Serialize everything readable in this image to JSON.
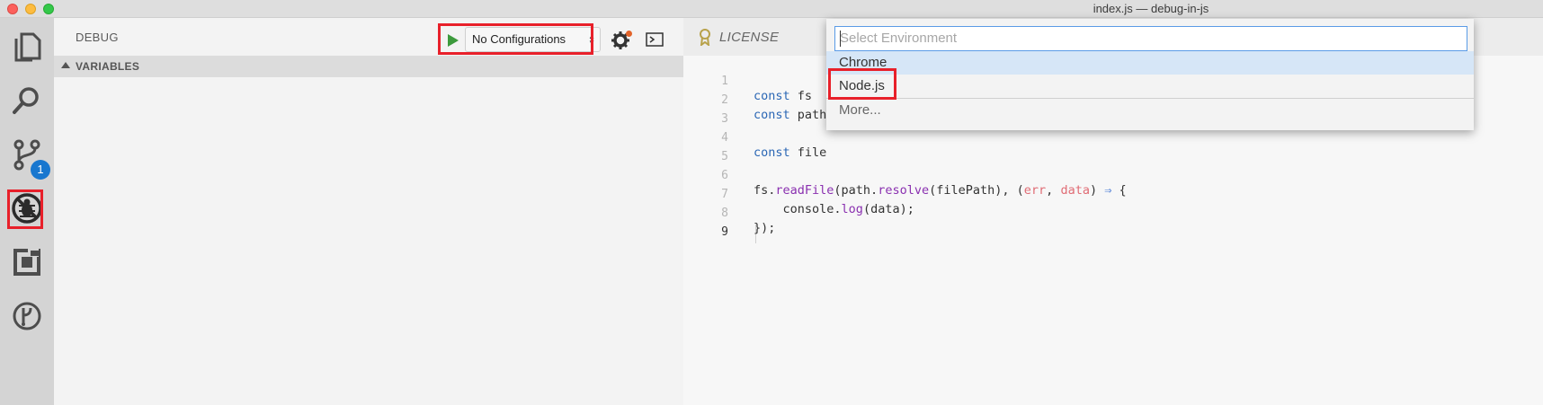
{
  "window": {
    "title": "index.js — debug-in-js"
  },
  "activity_bar": {
    "items": [
      {
        "name": "explorer",
        "icon": "files-icon"
      },
      {
        "name": "search",
        "icon": "search-icon"
      },
      {
        "name": "source-control",
        "icon": "source-control-icon",
        "badge": "1"
      },
      {
        "name": "debug",
        "icon": "debug-icon"
      },
      {
        "name": "extensions",
        "icon": "extensions-icon"
      },
      {
        "name": "remote",
        "icon": "remote-icon"
      }
    ]
  },
  "debug_panel": {
    "title": "DEBUG",
    "configuration": "No Configurations",
    "sections": [
      {
        "label": "VARIABLES",
        "expanded": true
      }
    ]
  },
  "editor": {
    "tab": {
      "label": "LICENSE",
      "icon": "license-icon"
    },
    "lines": [
      {
        "number": "1",
        "text": "const fs "
      },
      {
        "number": "2",
        "text": "const path"
      },
      {
        "number": "3",
        "text": ""
      },
      {
        "number": "4",
        "text": "const file"
      },
      {
        "number": "5",
        "text": ""
      },
      {
        "number": "6",
        "text": "fs.readFile(path.resolve(filePath), (err, data) ⇒ {"
      },
      {
        "number": "7",
        "text": "    console.log(data);"
      },
      {
        "number": "8",
        "text": "});"
      },
      {
        "number": "9",
        "text": ""
      }
    ],
    "active_line": "9"
  },
  "quick_pick": {
    "placeholder": "Select Environment",
    "items": [
      {
        "label": "Chrome",
        "selected": true
      },
      {
        "label": "Node.js",
        "selected": false
      },
      {
        "label": "More...",
        "selected": false
      }
    ]
  },
  "colors": {
    "highlight_box": "#e8202a",
    "badge": "#1877cf",
    "keyword": "#2b67b5",
    "function": "#8a30b0",
    "parameter": "#e06c75",
    "run_button": "#3c9a3c"
  }
}
